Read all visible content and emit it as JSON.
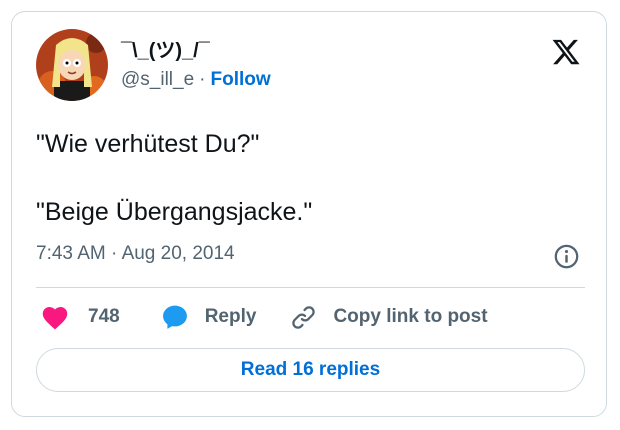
{
  "tweet": {
    "author": {
      "display_name": "¯\\_(ツ)_/¯",
      "handle": "@s_ill_e",
      "follow_label": "Follow",
      "separator": "·"
    },
    "text_lines": [
      "\"Wie verhütest Du?\"",
      "\"Beige Übergangsjacke.\""
    ],
    "time": "7:43 AM",
    "date": "Aug 20, 2014",
    "timestamp_separator": "·",
    "likes_count": "748",
    "reply_label": "Reply",
    "copy_link_label": "Copy link to post",
    "read_replies_label": "Read 16 replies"
  },
  "icons": {
    "brand": "x-logo-icon",
    "info": "info-icon",
    "like": "heart-icon",
    "reply": "speech-bubble-icon",
    "copy_link": "link-icon"
  },
  "colors": {
    "link": "#006fd6",
    "heart": "#f91880",
    "reply_bubble": "#1d9bf0",
    "secondary_text": "#536471",
    "border": "#cfd9de"
  }
}
